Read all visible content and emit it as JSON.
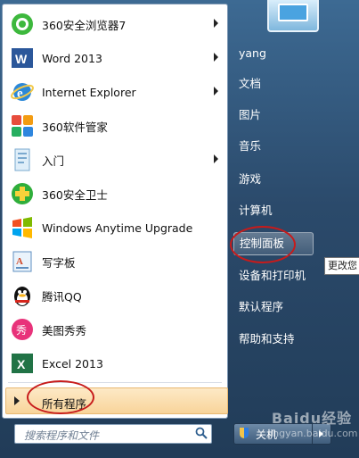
{
  "programs": [
    {
      "label": "360安全浏览器7",
      "icon": "360-browser-icon",
      "has_submenu": true
    },
    {
      "label": "Word 2013",
      "icon": "word-icon",
      "has_submenu": true
    },
    {
      "label": "Internet Explorer",
      "icon": "internet-explorer-icon",
      "has_submenu": true
    },
    {
      "label": "360软件管家",
      "icon": "360-software-manager-icon",
      "has_submenu": false
    },
    {
      "label": "入门",
      "icon": "getting-started-icon",
      "has_submenu": true
    },
    {
      "label": "360安全卫士",
      "icon": "360-security-guard-icon",
      "has_submenu": false
    },
    {
      "label": "Windows Anytime Upgrade",
      "icon": "windows-anytime-upgrade-icon",
      "has_submenu": false
    },
    {
      "label": "写字板",
      "icon": "wordpad-icon",
      "has_submenu": false
    },
    {
      "label": "腾讯QQ",
      "icon": "qq-penguin-icon",
      "has_submenu": false
    },
    {
      "label": "美图秀秀",
      "icon": "meitu-xiuxiu-icon",
      "has_submenu": false
    },
    {
      "label": "Excel 2013",
      "icon": "excel-icon",
      "has_submenu": false
    }
  ],
  "all_programs_label": "所有程序",
  "search": {
    "placeholder": "搜索程序和文件"
  },
  "right_panel": [
    {
      "label": "yang"
    },
    {
      "label": "文档"
    },
    {
      "label": "图片"
    },
    {
      "label": "音乐"
    },
    {
      "label": "游戏"
    },
    {
      "label": "计算机"
    },
    {
      "label": "控制面板",
      "highlighted": true
    },
    {
      "label": "设备和打印机"
    },
    {
      "label": "默认程序"
    },
    {
      "label": "帮助和支持"
    }
  ],
  "tooltip": "更改您",
  "shutdown_label": "关机",
  "watermark": {
    "line1": "Baidu经验",
    "line2": "jingyan.baidu.com"
  },
  "colors": {
    "highlight_oval": "#c71b1b",
    "all_programs_bg": "#f8d49a"
  }
}
